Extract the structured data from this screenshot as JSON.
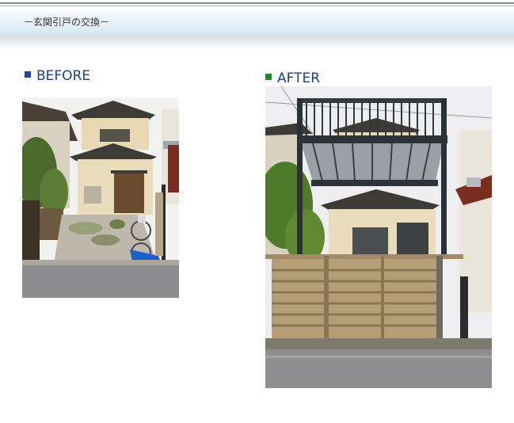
{
  "header": {
    "title": "－玄関引戸の交換－"
  },
  "before": {
    "label": "BEFORE",
    "photo_icon": "house-before-photo"
  },
  "after": {
    "label": "AFTER",
    "photo_icon": "house-after-photo"
  },
  "colors": {
    "label_text": "#1d3f8a",
    "before_square": "#1f45a3",
    "after_square": "#1f8a1f",
    "header_band": "#d4e6f3"
  }
}
